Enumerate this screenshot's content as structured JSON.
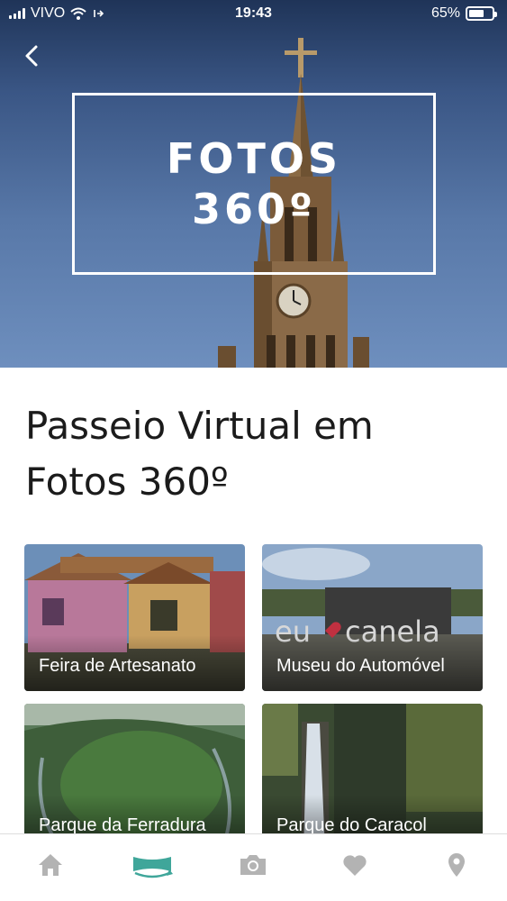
{
  "status_bar": {
    "carrier": "VIVO",
    "time": "19:43",
    "battery": "65%",
    "battery_level": 0.65
  },
  "hero": {
    "title_line1": "FOTOS",
    "title_line2": "360º",
    "back_icon": "chevron-left-icon"
  },
  "main": {
    "heading": "Passeio Virtual em Fotos 360º",
    "cards": [
      {
        "label": "Feira de Artesanato"
      },
      {
        "label": "Museu do Automóvel"
      },
      {
        "label": "Parque da Ferradura"
      },
      {
        "label": "Parque do Caracol"
      }
    ]
  },
  "bottom_nav": {
    "items": [
      {
        "icon": "home-icon"
      },
      {
        "icon": "panorama-360-icon",
        "active": true
      },
      {
        "icon": "camera-icon"
      },
      {
        "icon": "heart-icon"
      },
      {
        "icon": "location-pin-icon"
      }
    ],
    "inactive_color": "#b3b3b3",
    "active_color": "#3fa69a"
  }
}
